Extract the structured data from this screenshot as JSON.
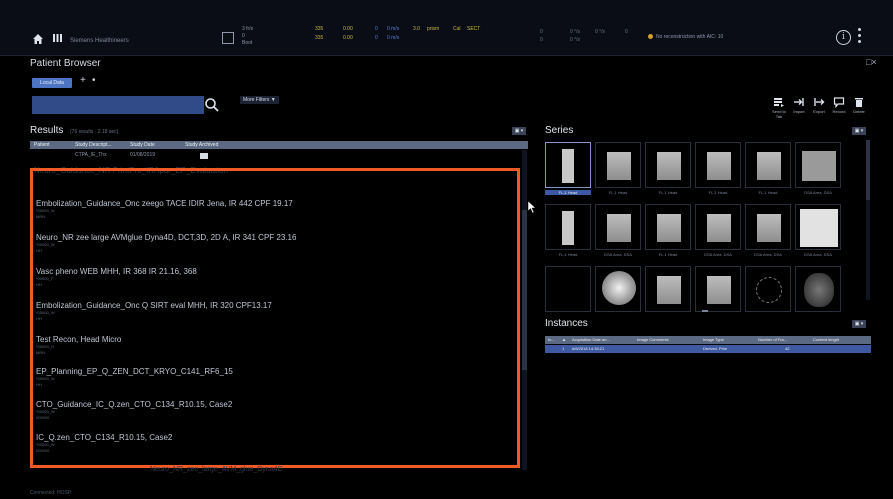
{
  "topbar": {
    "app_title": "Siemens Healthineers",
    "play_labels": [
      "3 fr/s",
      "0",
      "Boot"
    ],
    "stats_left": [
      "335",
      "0.00",
      "0",
      "0 m/s",
      "3.0",
      "prism",
      "Cal",
      "SECT"
    ],
    "stats_right": [
      "0",
      "0 °/s",
      "0 °/s",
      "0",
      "0"
    ],
    "recon_status": "No reconstruction with AIC: 10"
  },
  "patient_browser": {
    "title": "Patient Browser",
    "list_button": "Local Data",
    "add_symbol": "+",
    "more_symbol": "•",
    "search_placeholder": "",
    "more_filters": "More Filters ▼",
    "close_symbol": "□×"
  },
  "actions": [
    {
      "icon": "send-icon",
      "label": "Send to Tab"
    },
    {
      "icon": "import-icon",
      "label": "Import"
    },
    {
      "icon": "export-icon",
      "label": "Export"
    },
    {
      "icon": "record-icon",
      "label": "Record"
    },
    {
      "icon": "delete-icon",
      "label": "Delete"
    }
  ],
  "results": {
    "title": "Results",
    "count_text": "(76 results · 2.18 sec)",
    "tool_label": "▣ ▾",
    "columns": [
      "Patient",
      "Study Descript...",
      "Study Date",
      "Study Archived"
    ],
    "first_row": [
      "CTPA_IE_Thx",
      "01/08/2019"
    ],
    "ghost_top": "Neuro_Guidance_NR PrintPro_IRApar_EP_Evaluation",
    "ghost_bottom": "Neuro_NR_zee_large_AVM_glue_Dyna4D",
    "items": [
      {
        "name": "Embolization_Guidance_Onc zeego TACE IDIR Jena, IR 442 CPF 19.17",
        "sub": [
          "*00000_W",
          "MRN"
        ]
      },
      {
        "name": "Neuro_NR zee large AVMglue Dyna4D, DCT,3D, 2D A, IR 341 CPF 23.16",
        "sub": [
          "*00000_W",
          "HH"
        ]
      },
      {
        "name": "Vasc pheno WEB MHH, IR 368 IR 21.16, 368",
        "sub": [
          "*00000_F",
          "HH"
        ]
      },
      {
        "name": "Embolization_Guidance_Onc Q SIRT eval MHH, IR 320 CPF13.17",
        "sub": [
          "*00000_W",
          "HH"
        ]
      },
      {
        "name": "Test Recon, Head Micro",
        "sub": [
          "*00000_H",
          "MRN"
        ]
      },
      {
        "name": "EP_Planning_EP_Q_ZEN_DCT_KRYO_C141_RF6_15",
        "sub": [
          "*00000_W",
          "HH"
        ]
      },
      {
        "name": "CTO_Guidance_IC_Q.zen_CTO_C134_R10.15, Case2",
        "sub": [
          "*00000_W",
          "000000"
        ]
      },
      {
        "name": "IC_Q.zen_CTO_C134_R10.15, Case2",
        "sub": [
          "*00000_W",
          "000000"
        ]
      }
    ]
  },
  "series": {
    "title": "Series",
    "tool_label": "▣ ▾",
    "thumbs": [
      {
        "cap": "FL,1 Head",
        "style": "bar"
      },
      {
        "cap": "FL,1 Head",
        "style": "plate"
      },
      {
        "cap": "FL,1 Head",
        "style": "plate"
      },
      {
        "cap": "FL,1 Head",
        "style": "plate"
      },
      {
        "cap": "FL,1 Head",
        "style": "plate"
      },
      {
        "cap": "DSA Area, DSA",
        "style": "square"
      },
      {
        "cap": "FL,1 Head",
        "style": "bar"
      },
      {
        "cap": "DSA Area, DSA",
        "style": "plate"
      },
      {
        "cap": "FL,1 Head",
        "style": "plate"
      },
      {
        "cap": "DSA Area, DSA",
        "style": "plate"
      },
      {
        "cap": "DSA Area, DSA",
        "style": "plate"
      },
      {
        "cap": "DSA Area, DSA",
        "style": "bright"
      },
      {
        "cap": "",
        "style": "blank"
      },
      {
        "cap": "",
        "style": "knee"
      },
      {
        "cap": "",
        "style": "plate"
      },
      {
        "cap": "",
        "style": "plate"
      },
      {
        "cap": "",
        "style": "ring"
      },
      {
        "cap": "",
        "style": "skull"
      }
    ]
  },
  "instances": {
    "title": "Instances",
    "tool_label": "▣ ▾",
    "columns": [
      "In...",
      "▲",
      "Acquisition Date an...",
      "Image Comments",
      "Image Type",
      "Number of Fra...",
      "Content length"
    ],
    "row": [
      "1",
      "6/6/2018 14:35:21",
      "Derived, Prim",
      "42"
    ]
  },
  "status_text": "Connected: HOSP",
  "colors": {
    "accent": "#4e74c4",
    "highlight": "#f05a24",
    "header_row": "#5c6983",
    "selected_row": "#3e5aa3"
  }
}
